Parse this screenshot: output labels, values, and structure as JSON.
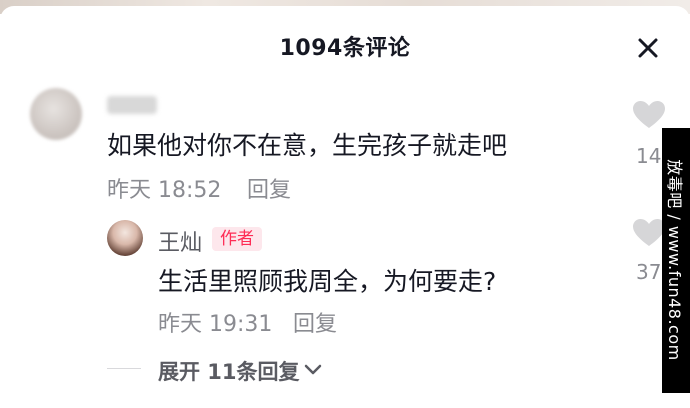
{
  "header": {
    "title": "1094条评论",
    "close_icon": "close-icon"
  },
  "comment": {
    "text": "如果他对你不在意，生完孩子就走吧",
    "time": "昨天 18:52",
    "reply_label": "回复",
    "like_icon": "heart-icon",
    "like_count": "14"
  },
  "reply": {
    "username": "王灿",
    "badge": "作者",
    "text": "生活里照顾我周全，为何要走?",
    "time": "昨天 19:31",
    "reply_label": "回复",
    "like_icon": "heart-icon",
    "like_count": "37"
  },
  "expand": {
    "label": "展开 11条回复",
    "icon": "chevron-down-icon"
  },
  "watermark": {
    "text": "放毒吧 / www.fun48.com"
  },
  "colors": {
    "badge_bg": "#fde7ec",
    "badge_text": "#fe2c55",
    "meta_text": "#8a8b91"
  }
}
